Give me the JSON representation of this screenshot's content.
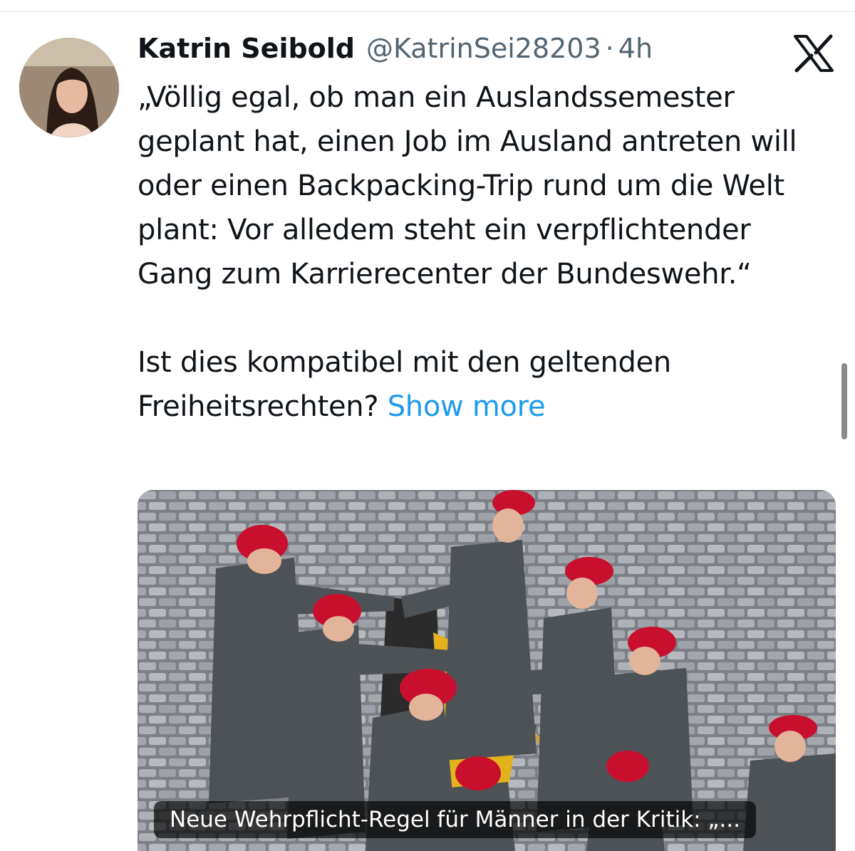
{
  "tweet": {
    "author_name": "Katrin Seibold",
    "handle": "@KatrinSei28203",
    "separator": "·",
    "time": "4h",
    "text_paragraph_1": "„Völlig egal, ob man ein Auslandssemester geplant hat, einen Job im Ausland antreten will oder einen Backpacking-Trip rund um die Welt plant: Vor alledem steht ein verpflichtender Gang zum Karrierecenter der Bundeswehr.“",
    "text_paragraph_2": "Ist dies kompatibel mit den geltenden Freiheitsrechten?",
    "show_more_label": "Show more"
  },
  "media": {
    "caption": "Neue Wehrpflicht-Regel für Männer in der Kritik: „..."
  },
  "icons": {
    "platform_logo": "x-logo-icon"
  },
  "colors": {
    "link": "#1d9bf0",
    "secondary_text": "#536471",
    "primary_text": "#0f1419",
    "beret": "#c8102e",
    "uniform": "#4d5257"
  }
}
